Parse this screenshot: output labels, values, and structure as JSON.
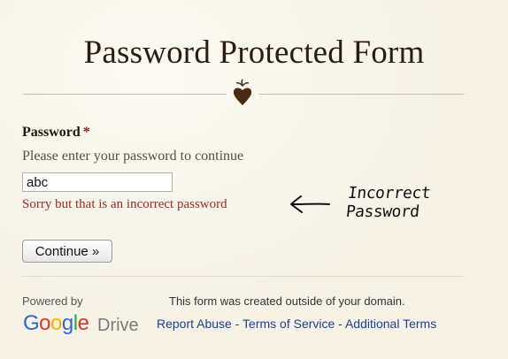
{
  "form": {
    "title": "Password Protected Form",
    "field_label": "Password",
    "required_marker": "*",
    "help_text": "Please enter your password to continue",
    "password_value": "abc",
    "error_message": "Sorry but that is an incorrect password",
    "continue_label": "Continue »"
  },
  "annotation": {
    "text": "Incorrect Password",
    "arrow_icon": "hand-drawn-left-arrow-icon"
  },
  "ornament": {
    "icon": "heart-ornament-icon",
    "color": "#4a2a10"
  },
  "footer": {
    "powered_by": "Powered by",
    "brand_letters": [
      "G",
      "o",
      "o",
      "g",
      "l",
      "e"
    ],
    "brand_product": "Drive",
    "domain_note": "This form was created outside of your domain.",
    "links": {
      "report_abuse": "Report Abuse",
      "separator": " - ",
      "terms_of_service": "Terms of Service",
      "additional_terms": "Additional Terms"
    }
  },
  "colors": {
    "background": "#f6f2e6",
    "error": "#9b2b24",
    "required": "#8b1a1a",
    "link": "#1f3f94"
  }
}
